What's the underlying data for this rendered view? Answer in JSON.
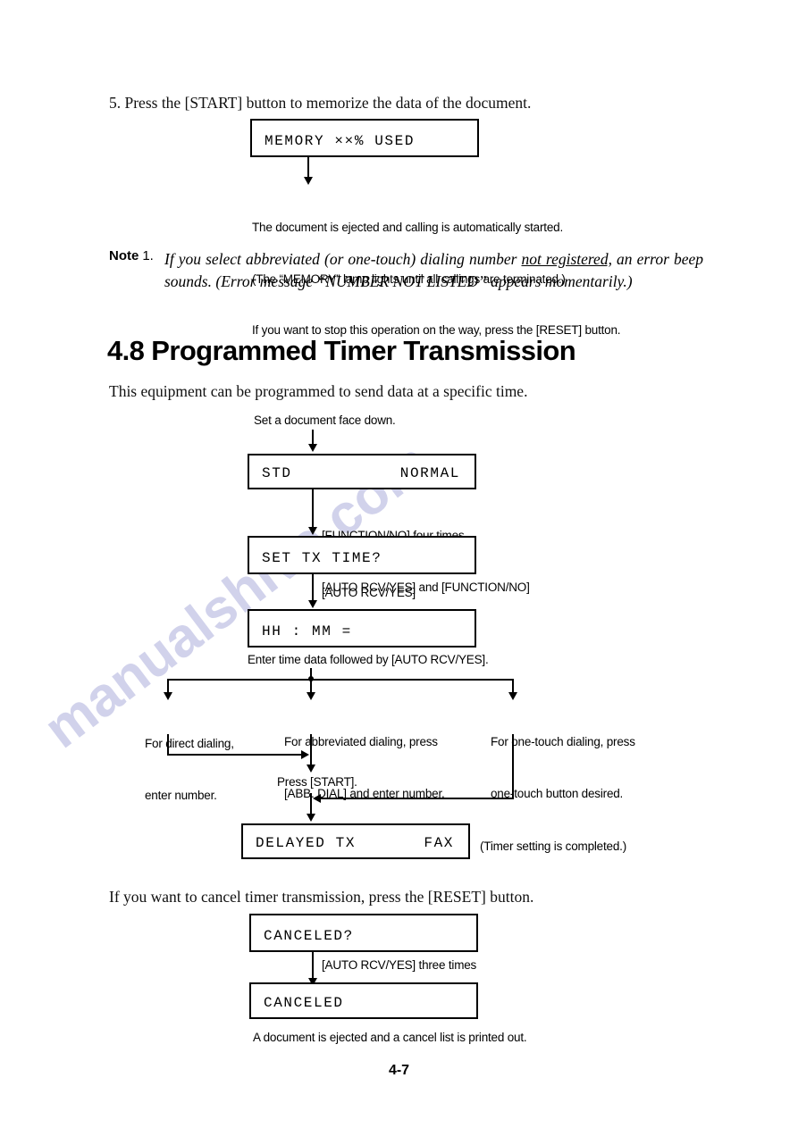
{
  "page": {
    "footer_page_number": "4-7"
  },
  "watermark": {
    "text": "manualshive.com",
    "color": "#c9cbe8"
  },
  "step5": {
    "text": "5. Press the [START] button to memorize the data of the document.",
    "lcd_memory": {
      "left": "MEMORY  ××% USED"
    },
    "outcome_lines": [
      "The document is ejected and calling is automatically started.",
      "(The “MEMORY” lamp lights until all callings are terminated.)",
      "If you want to stop this operation on the way, press the [RESET] button."
    ]
  },
  "note": {
    "label": "Note",
    "number": "1.",
    "line1_a": "If you select abbreviated (or one-touch) dialing number ",
    "line1_underlined": "not registered,",
    "line1_b": " an error beep sounds. (Error message  “NUMBER NOT LISTED”  appears momentarily.)"
  },
  "section": {
    "heading": "4.8 Programmed Timer Transmission",
    "intro": "This equipment can be programmed to send data at a specific time."
  },
  "flow": {
    "start_caption": "Set a document face down.",
    "lcd_std": {
      "left": "STD",
      "right": "NORMAL"
    },
    "step1_caption_line1": "[FUNCTION/NO] four times,",
    "step1_caption_line2": "[AUTO RCV/YES] and [FUNCTION/NO]",
    "lcd_set_tx_time": {
      "left": "SET TX TIME?"
    },
    "step2_caption": "[AUTO RCV/YES]",
    "lcd_hh_mm": {
      "left": "HH : MM ="
    },
    "step3_caption": "Enter time data followed by [AUTO RCV/YES].",
    "branch_left_line1": "For direct dialing,",
    "branch_left_line2": "enter number.",
    "branch_mid_line1": "For abbreviated dialing, press",
    "branch_mid_line2": "[ABB. DIAL] and enter number.",
    "branch_right_line1": "For one-touch dialing, press",
    "branch_right_line2": "one-touch button desired.",
    "press_start_caption": "Press [START].",
    "lcd_delayed_tx": {
      "left": "DELAYED TX",
      "right": "FAX"
    },
    "delayed_tx_note": "(Timer setting is completed.)"
  },
  "cancel": {
    "intro": "If you want to cancel timer transmission, press the [RESET] button.",
    "lcd_canceled_q": {
      "left": "CANCELED?"
    },
    "caption": "[AUTO RCV/YES] three times",
    "lcd_canceled": {
      "left": "CANCELED"
    },
    "outcome": "A document is ejected and a cancel list is printed out."
  }
}
